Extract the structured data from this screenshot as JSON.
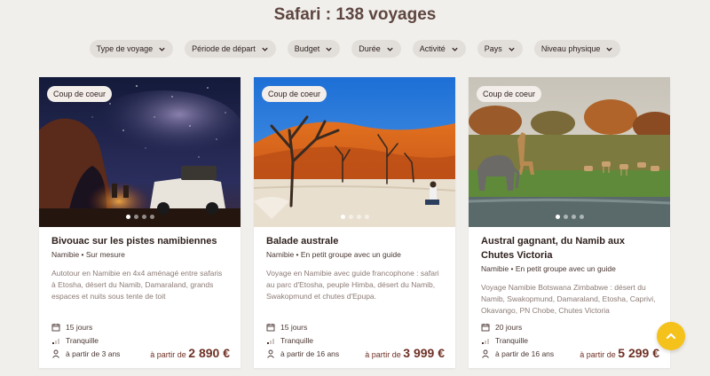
{
  "header": {
    "title": "Safari : 138 voyages"
  },
  "filters": [
    {
      "label": "Type de voyage"
    },
    {
      "label": "Période de départ"
    },
    {
      "label": "Budget"
    },
    {
      "label": "Durée"
    },
    {
      "label": "Activité"
    },
    {
      "label": "Pays"
    },
    {
      "label": "Niveau physique"
    }
  ],
  "cards": [
    {
      "badge": "Coup de coeur",
      "title": "Bivouac sur les pistes namibiennes",
      "subtitle": "Namibie • Sur mesure",
      "description": "Autotour en Namibie en 4x4 aménagé entre safaris à Etosha, désert du Namib, Damaraland, grands espaces et nuits sous tente de toit",
      "duration": "15 jours",
      "level": "Tranquille",
      "age": "à partir de 3 ans",
      "price_prefix": "à partir de",
      "price": "2 890 €"
    },
    {
      "badge": "Coup de coeur",
      "title": "Balade australe",
      "subtitle": "Namibie • En petit groupe avec un guide",
      "description": "Voyage en Namibie avec guide francophone : safari au parc d'Etosha, peuple Himba, désert du Namib, Swakopmund et chutes d'Epupa.",
      "duration": "15 jours",
      "level": "Tranquille",
      "age": "à partir de 16 ans",
      "price_prefix": "à partir de",
      "price": "3 999 €"
    },
    {
      "badge": "Coup de coeur",
      "title": "Austral gagnant, du Namib aux Chutes Victoria",
      "subtitle": "Namibie • En petit groupe avec un guide",
      "description": "Voyage Namibie Botswana Zimbabwe : désert du Namib, Swakopmund, Damaraland, Etosha, Caprivi, Okavango, PN Chobe, Chutes Victoria",
      "duration": "20 jours",
      "level": "Tranquille",
      "age": "à partir de 16 ans",
      "price_prefix": "à partir de",
      "price": "5 299 €"
    }
  ],
  "colors": {
    "accent": "#f4c21b",
    "price": "#6f3126",
    "background": "#f1efec"
  }
}
